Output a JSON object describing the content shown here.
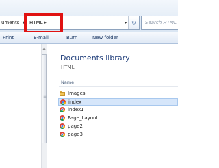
{
  "address": {
    "breadcrumbs": [
      "uments",
      "HTML"
    ],
    "separator": "▸",
    "dropdown": "▾",
    "refresh": "↻"
  },
  "search": {
    "placeholder": "Search HTML"
  },
  "toolbar": {
    "buttons": [
      "Print",
      "E-mail",
      "Burn",
      "New folder"
    ]
  },
  "library": {
    "title": "Documents library",
    "subtitle": "HTML",
    "column_header": "Name"
  },
  "files": [
    {
      "name": "Images",
      "type": "folder",
      "selected": false
    },
    {
      "name": "index",
      "type": "chrome-html",
      "selected": true
    },
    {
      "name": "index1",
      "type": "chrome-html",
      "selected": false
    },
    {
      "name": "Page_Layout",
      "type": "chrome-html",
      "selected": false
    },
    {
      "name": "page2",
      "type": "chrome-html",
      "selected": false
    },
    {
      "name": "page3",
      "type": "chrome-html",
      "selected": false
    }
  ],
  "colors": {
    "highlight_box": "#e01212",
    "library_title": "#1e3d7a",
    "selection": "#d6e6fa"
  },
  "icons": {
    "folder": "folder-icon",
    "chrome": "chrome-icon"
  }
}
